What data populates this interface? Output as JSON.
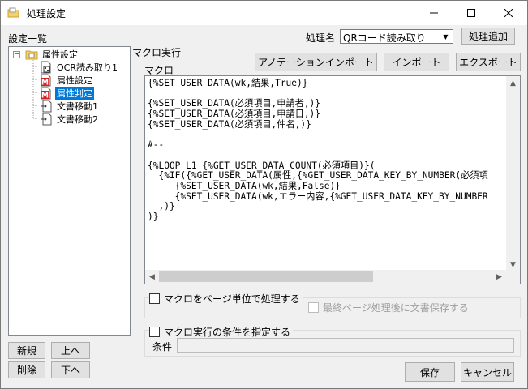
{
  "window": {
    "title": "処理設定",
    "icon": "folder-icon"
  },
  "left": {
    "list_label": "設定一覧",
    "tree": [
      {
        "label": "属性設定",
        "icon": "folder-icon",
        "expander": "−"
      },
      {
        "label": "OCR読み取り1",
        "icon": "ocr-document-icon"
      },
      {
        "label": "属性設定",
        "icon": "macro-icon"
      },
      {
        "label": "属性判定",
        "icon": "macro-icon",
        "selected": true
      },
      {
        "label": "文書移動1",
        "icon": "move-document-icon"
      },
      {
        "label": "文書移動2",
        "icon": "move-document-icon"
      }
    ],
    "buttons": {
      "new": "新規",
      "up": "上へ",
      "delete": "削除",
      "down": "下へ"
    }
  },
  "top": {
    "process_name_label": "処理名",
    "process_name_value": "QRコード読み取り",
    "add_process": "処理追加"
  },
  "macro": {
    "section_title": "マクロ実行",
    "macro_label": "マクロ",
    "annotation_import": "アノテーションインポート",
    "import": "インポート",
    "export": "エクスポート",
    "code": "{%SET_USER_DATA(wk,結果,True)}\n\n{%SET_USER_DATA(必須項目,申請者,)}\n{%SET_USER_DATA(必須項目,申請日,)}\n{%SET_USER_DATA(必須項目,件名,)}\n\n#--\n\n{%LOOP L1 {%GET_USER_DATA_COUNT(必須項目)}(\n  {%IF({%GET_USER_DATA(属性,{%GET_USER_DATA_KEY_BY_NUMBER(必須項\n     {%SET_USER_DATA(wk,結果,False)}\n     {%SET_USER_DATA(wk,エラー内容,{%GET_USER_DATA_KEY_BY_NUMBER\n  ,)}\n)}"
  },
  "options": {
    "per_page": "マクロをページ単位で処理する",
    "save_after_last": "最終ページ処理後に文書保存する",
    "condition_toggle": "マクロ実行の条件を指定する",
    "condition_label": "条件",
    "condition_value": ""
  },
  "footer": {
    "save": "保存",
    "cancel": "キャンセル"
  },
  "colors": {
    "selection": "#0078d7",
    "window_bg": "#f0f0f0",
    "button_bg": "#e1e1e1"
  }
}
